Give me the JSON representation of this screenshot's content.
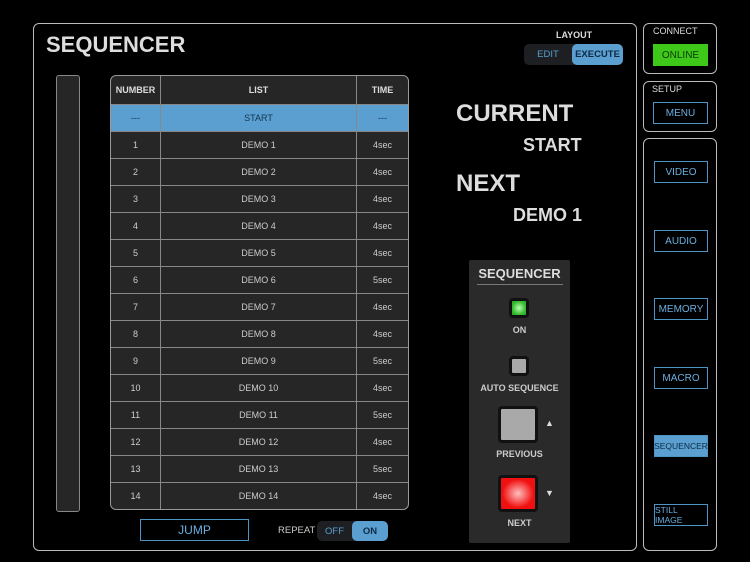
{
  "header": {
    "title": "SEQUENCER",
    "layout_label": "LAYOUT",
    "layout_options": [
      "EDIT",
      "EXECUTE"
    ],
    "layout_selected": "EXECUTE"
  },
  "connect": {
    "label": "CONNECT",
    "status": "ONLINE",
    "status_color": "#3ec81a"
  },
  "setup": {
    "label": "SETUP",
    "menu": "MENU"
  },
  "nav": {
    "items": [
      "VIDEO",
      "AUDIO",
      "MEMORY",
      "MACRO",
      "SEQUENCER",
      "STILL IMAGE"
    ],
    "selected": "SEQUENCER"
  },
  "table": {
    "headers": [
      "NUMBER",
      "LIST",
      "TIME"
    ],
    "rows": [
      [
        "---",
        "START",
        "---"
      ],
      [
        "1",
        "DEMO 1",
        "4sec"
      ],
      [
        "2",
        "DEMO 2",
        "4sec"
      ],
      [
        "3",
        "DEMO 3",
        "4sec"
      ],
      [
        "4",
        "DEMO 4",
        "4sec"
      ],
      [
        "5",
        "DEMO 5",
        "4sec"
      ],
      [
        "6",
        "DEMO 6",
        "5sec"
      ],
      [
        "7",
        "DEMO 7",
        "4sec"
      ],
      [
        "8",
        "DEMO 8",
        "4sec"
      ],
      [
        "9",
        "DEMO 9",
        "5sec"
      ],
      [
        "10",
        "DEMO 10",
        "4sec"
      ],
      [
        "11",
        "DEMO 11",
        "5sec"
      ],
      [
        "12",
        "DEMO 12",
        "4sec"
      ],
      [
        "13",
        "DEMO 13",
        "5sec"
      ],
      [
        "14",
        "DEMO 14",
        "4sec"
      ]
    ],
    "selected_index": 0
  },
  "footer": {
    "jump": "JUMP",
    "repeat_label": "REPEAT",
    "repeat_options": [
      "OFF",
      "ON"
    ],
    "repeat_selected": "ON"
  },
  "status": {
    "current_label": "CURRENT",
    "current_value": "START",
    "next_label": "NEXT",
    "next_value": "DEMO 1"
  },
  "sequencer": {
    "title": "SEQUENCER",
    "on": "ON",
    "auto": "AUTO SEQUENCE",
    "previous": "PREVIOUS",
    "next": "NEXT",
    "up_arrow": "▲",
    "down_arrow": "▼"
  }
}
